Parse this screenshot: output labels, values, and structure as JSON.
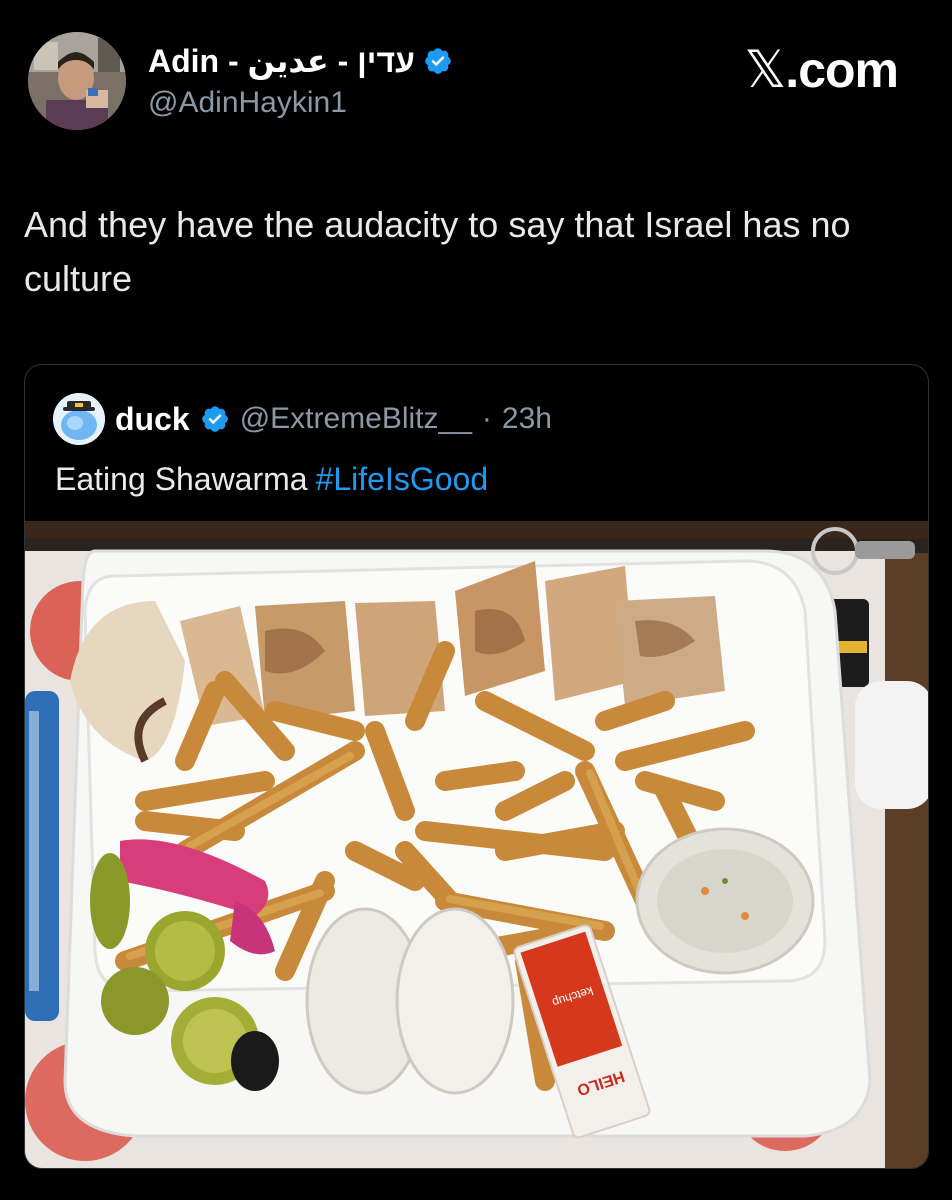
{
  "tweet": {
    "display_name": "Adin - עדין - عدين",
    "handle": "@AdinHaykin1",
    "verified": true,
    "text": "And they have the audacity to say that Israel has no culture",
    "brand": ".com",
    "brand_icon": "x-logo-icon"
  },
  "quoted": {
    "display_name": "duck",
    "handle": "@ExtremeBlitz__",
    "separator": "·",
    "time": "23h",
    "text": "Eating Shawarma",
    "hashtag": "#LifeIsGood",
    "verified": true
  },
  "media": {
    "ketchup_label": "ketchup",
    "brand_label": "HEILO"
  },
  "colors": {
    "background": "#000000",
    "verified": "#1d9bf0",
    "hashtag": "#1d9bf0",
    "secondary_text": "#8b98a5"
  }
}
